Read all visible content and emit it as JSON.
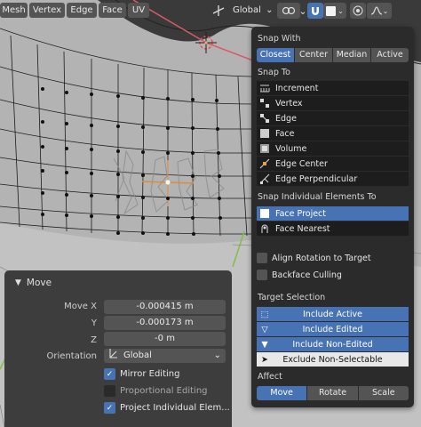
{
  "header": {
    "menus": [
      "Mesh",
      "Vertex",
      "Edge",
      "Face",
      "UV"
    ],
    "orientation": "Global",
    "icons": [
      "axis-gizmo-icon",
      "transform-pivot-icon",
      "link-icon",
      "magnet-icon",
      "snap-target-icon",
      "proportional-editing-icon",
      "falloff-icon"
    ]
  },
  "snap_popover": {
    "snap_with_label": "Snap With",
    "snap_with": [
      "Closest",
      "Center",
      "Median",
      "Active"
    ],
    "snap_with_selected": "Closest",
    "snap_to_label": "Snap To",
    "snap_to": [
      {
        "label": "Increment",
        "icon": "increment-icon",
        "on": false
      },
      {
        "label": "Vertex",
        "icon": "vertex-icon",
        "on": false
      },
      {
        "label": "Edge",
        "icon": "edge-icon",
        "on": false
      },
      {
        "label": "Face",
        "icon": "face-icon",
        "on": false
      },
      {
        "label": "Volume",
        "icon": "volume-icon",
        "on": false
      },
      {
        "label": "Edge Center",
        "icon": "edge-center-icon",
        "on": false
      },
      {
        "label": "Edge Perpendicular",
        "icon": "edge-perpendicular-icon",
        "on": false
      }
    ],
    "individual_label": "Snap Individual Elements To",
    "individual": [
      {
        "label": "Face Project",
        "icon": "face-project-icon",
        "on": true
      },
      {
        "label": "Face Nearest",
        "icon": "face-nearest-icon",
        "on": false
      }
    ],
    "align_rotation": {
      "label": "Align Rotation to Target",
      "checked": false
    },
    "backface_culling": {
      "label": "Backface Culling",
      "checked": false
    },
    "target_label": "Target Selection",
    "targets": [
      {
        "label": "Include Active",
        "icon": "include-active-icon",
        "on": true
      },
      {
        "label": "Include Edited",
        "icon": "include-edited-icon",
        "on": true
      },
      {
        "label": "Include Non-Edited",
        "icon": "include-non-edited-icon",
        "on": true
      },
      {
        "label": "Exclude Non-Selectable",
        "icon": "cursor-icon",
        "on": false
      }
    ],
    "affect_label": "Affect",
    "affect": [
      "Move",
      "Rotate",
      "Scale"
    ],
    "affect_selected": "Move"
  },
  "move_panel": {
    "title": "Move",
    "move_x_label": "Move X",
    "move_x": "-0.000415 m",
    "y_label": "Y",
    "y": "-0.000173 m",
    "z_label": "Z",
    "z": "-0 m",
    "orientation_label": "Orientation",
    "orientation": "Global",
    "mirror_editing": {
      "label": "Mirror Editing",
      "checked": true
    },
    "proportional_editing": {
      "label": "Proportional Editing",
      "checked": false
    },
    "project_individual": {
      "label": "Project Individual Elem...",
      "checked": true
    }
  },
  "colors": {
    "accent": "#4772b3",
    "panel": "#2b2b2b",
    "mesh_surface": "#b9b9b9",
    "edge": "#1a1a1a",
    "selected_edge": "#e08a3c",
    "active_vertex": "#ffffff"
  }
}
